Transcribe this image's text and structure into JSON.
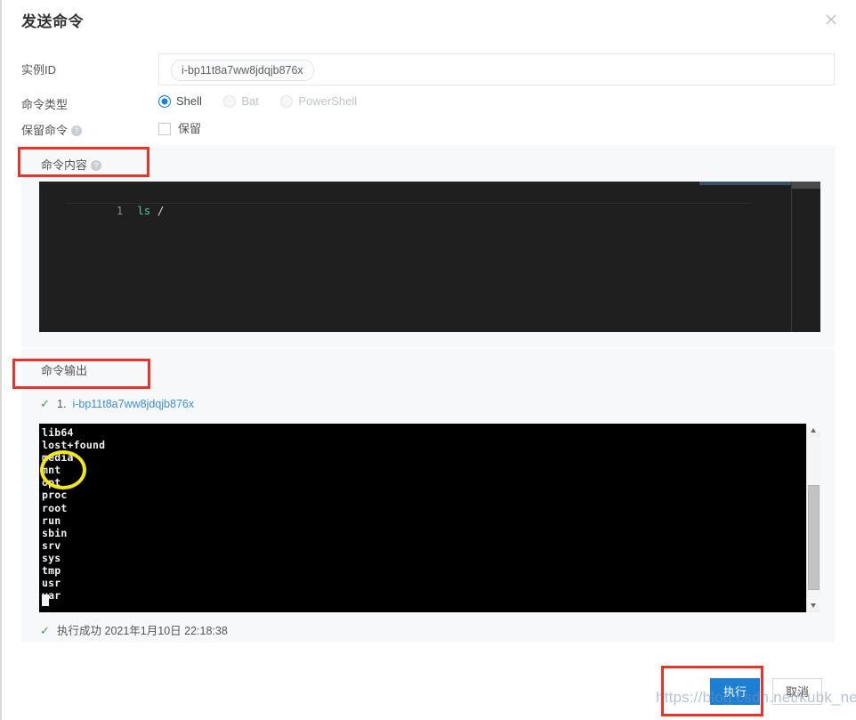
{
  "dialog": {
    "title": "发送命令",
    "close_icon": "close-icon"
  },
  "form": {
    "instance_id": {
      "label": "实例ID",
      "tag_value": "i-bp11t8a7ww8jdqjb876x"
    },
    "command_type": {
      "label": "命令类型",
      "options": [
        {
          "label": "Shell",
          "selected": true,
          "disabled": false
        },
        {
          "label": "Bat",
          "selected": false,
          "disabled": true
        },
        {
          "label": "PowerShell",
          "selected": false,
          "disabled": true
        }
      ]
    },
    "keep_command": {
      "label": "保留命令",
      "help": "?",
      "checkbox_label": "保留",
      "checked": false
    }
  },
  "command_content": {
    "title": "命令内容",
    "help": "?",
    "editor": {
      "line_number": "1",
      "command": "ls",
      "argument": "/"
    }
  },
  "command_output": {
    "title": "命令输出",
    "result": {
      "tick": "✓",
      "index": "1.",
      "instance_id": "i-bp11t8a7ww8jdqjb876x"
    },
    "terminal_lines": "lib64\nlost+found\nmedia\nmnt\nopt\nproc\nroot\nrun\nsbin\nsrv\nsys\ntmp\nusr\nvar",
    "status": {
      "tick": "✓",
      "text": "执行成功",
      "timestamp": "2021年1月10日 22:18:38"
    }
  },
  "footer": {
    "execute_label": "执行",
    "cancel_label": "取消"
  },
  "watermark": {
    "text": "https://blog.csdn.net/kubk_net"
  },
  "colors": {
    "primary": "#1d7fd1",
    "annotation_red": "#e8342a",
    "annotation_yellow": "#f2e719",
    "success_green": "#3aa03a",
    "link_blue": "#3f8fd6",
    "editor_bg": "#1f1f1f",
    "terminal_bg": "#000000",
    "panel_bg": "#f7f8f9"
  }
}
